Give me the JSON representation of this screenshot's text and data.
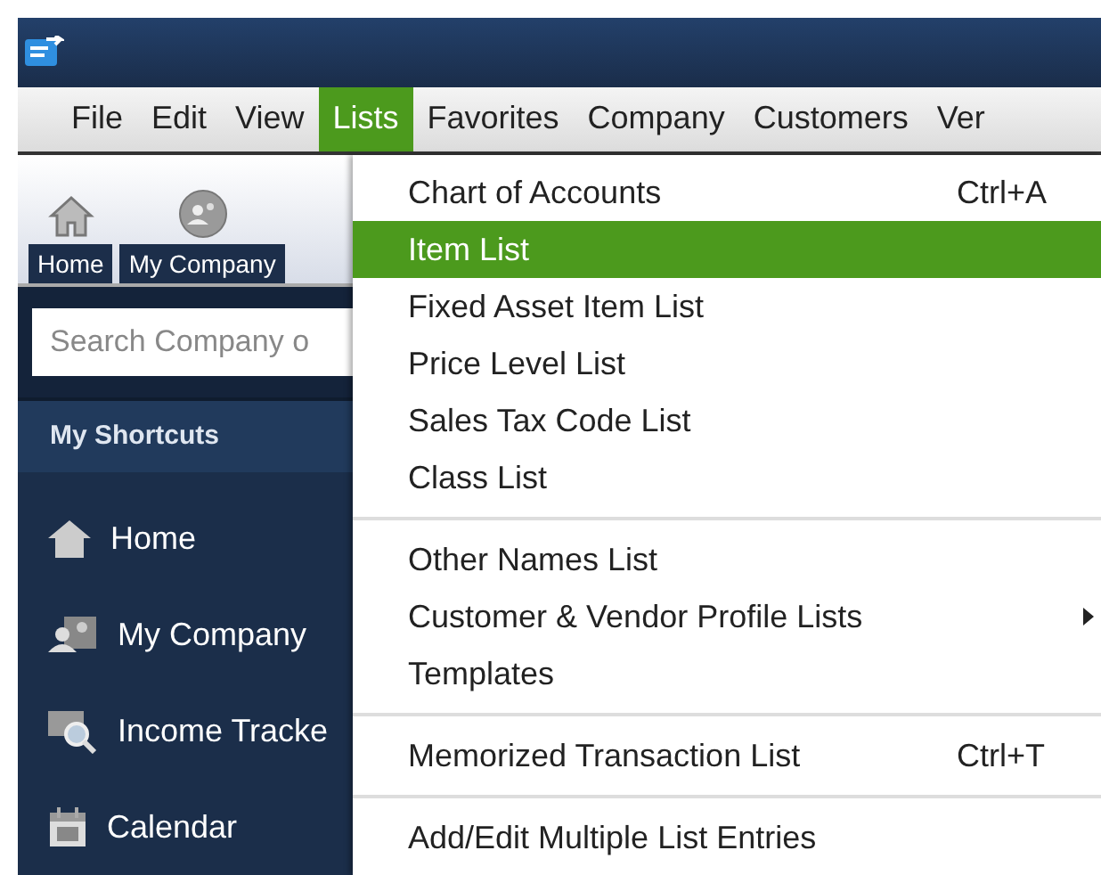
{
  "menu_bar": [
    {
      "label": "File",
      "selected": false
    },
    {
      "label": "Edit",
      "selected": false
    },
    {
      "label": "View",
      "selected": false
    },
    {
      "label": "Lists",
      "selected": true
    },
    {
      "label": "Favorites",
      "selected": false
    },
    {
      "label": "Company",
      "selected": false
    },
    {
      "label": "Customers",
      "selected": false
    },
    {
      "label": "Ver",
      "selected": false
    }
  ],
  "icon_bar": [
    {
      "kind": "home",
      "label": "Home"
    },
    {
      "kind": "company",
      "label": "My Company"
    }
  ],
  "search": {
    "placeholder": "Search Company o"
  },
  "shortcuts": {
    "title": "My Shortcuts",
    "items": [
      {
        "kind": "home",
        "label": "Home"
      },
      {
        "kind": "company",
        "label": "My Company"
      },
      {
        "kind": "income",
        "label": "Income Tracke"
      },
      {
        "kind": "calendar",
        "label": "Calendar"
      }
    ]
  },
  "lists_menu": [
    [
      {
        "label": "Chart of Accounts",
        "shortcut": "Ctrl+A",
        "selected": false,
        "submenu": false
      },
      {
        "label": "Item List",
        "selected": true,
        "submenu": false
      },
      {
        "label": "Fixed Asset Item List",
        "selected": false,
        "submenu": false
      },
      {
        "label": "Price Level List",
        "selected": false,
        "submenu": false
      },
      {
        "label": "Sales Tax Code List",
        "selected": false,
        "submenu": false
      },
      {
        "label": "Class List",
        "selected": false,
        "submenu": false
      }
    ],
    [
      {
        "label": "Other Names List",
        "selected": false,
        "submenu": false
      },
      {
        "label": "Customer & Vendor Profile Lists",
        "selected": false,
        "submenu": true
      },
      {
        "label": "Templates",
        "selected": false,
        "submenu": false
      }
    ],
    [
      {
        "label": "Memorized Transaction List",
        "shortcut": "Ctrl+T",
        "selected": false,
        "submenu": false
      }
    ],
    [
      {
        "label": "Add/Edit Multiple List Entries",
        "selected": false,
        "submenu": false
      }
    ]
  ]
}
